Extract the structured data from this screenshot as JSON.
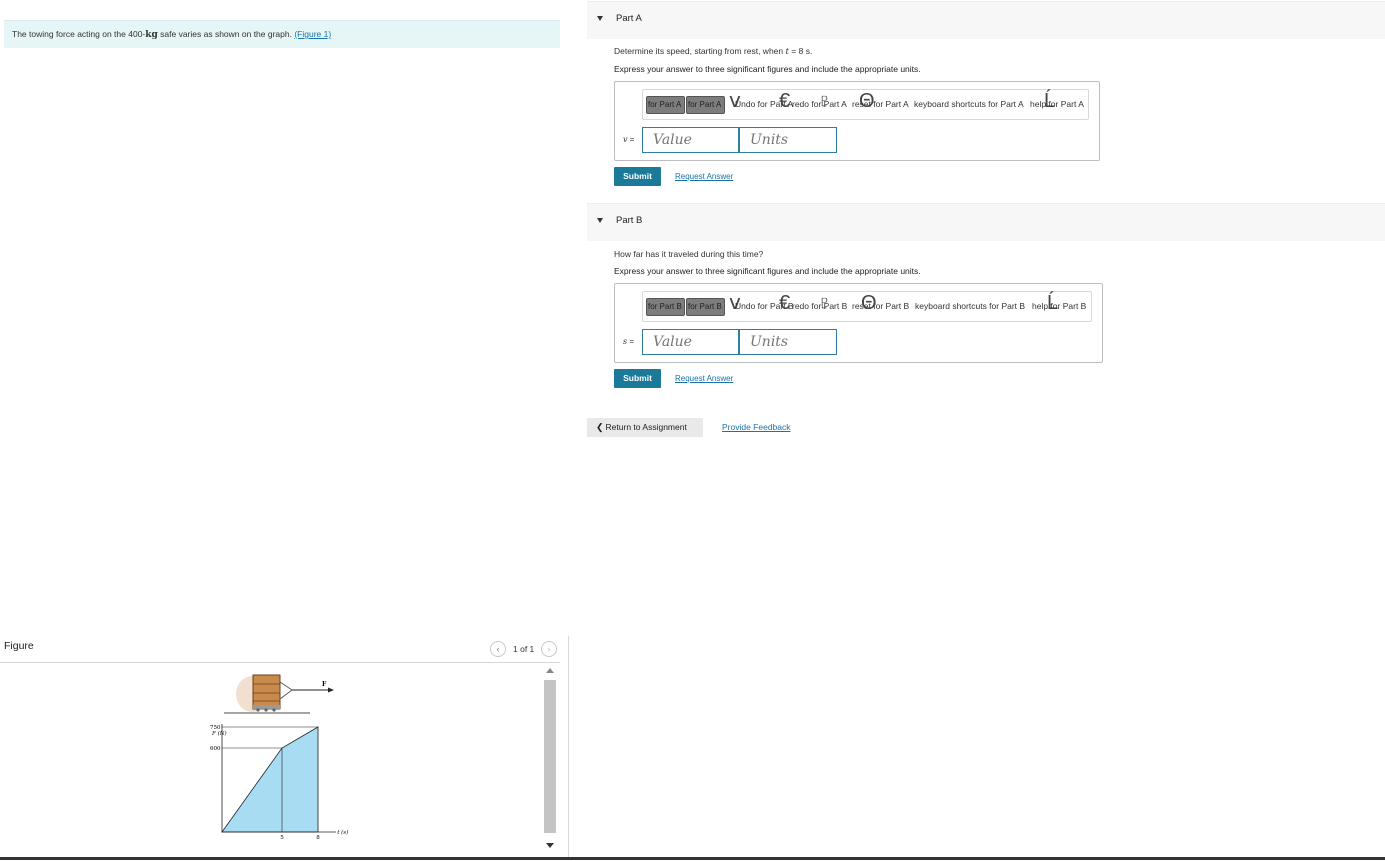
{
  "problem": {
    "text": "The towing force acting on the 400-",
    "unit": "kg",
    "text_after": " safe varies as shown on the graph. ",
    "figure_link": "(Figure 1)"
  },
  "figure": {
    "title": "Figure",
    "pager": "1 of 1",
    "force_label": "F",
    "y_axis_label": "F (N)",
    "y_tick_high": "750",
    "y_tick_low": "600",
    "x_tick_1": "5",
    "x_tick_2": "8",
    "x_axis_label": "t (s)"
  },
  "chart_data": {
    "type": "area",
    "x": [
      0,
      5,
      5,
      8
    ],
    "y": [
      0,
      600,
      600,
      750
    ],
    "xlabel": "t (s)",
    "ylabel": "F (N)",
    "x_ticks": [
      5,
      8
    ],
    "y_ticks": [
      600,
      750
    ],
    "xlim": [
      0,
      10
    ],
    "ylim": [
      0,
      800
    ],
    "fill_color": "#a8dcf3",
    "grid": false
  },
  "partA": {
    "title": "Part A",
    "question_prefix": "Determine its speed, starting from rest, when ",
    "question_var": "t",
    "question_suffix": " = 8 s.",
    "instruction": "Express your answer to three significant figures and include the appropriate units.",
    "toolbar": {
      "btn1": "for Part A",
      "btn2": "for Part A",
      "undo": "Undo for Part A",
      "redo": "redo for Part A",
      "reset": "reset for Part A",
      "shortcuts": "keyboard shortcuts for Part A",
      "help": "help for Part A"
    },
    "variable": "v",
    "equals": " =",
    "value_placeholder": "Value",
    "units_placeholder": "Units",
    "submit": "Submit",
    "request_answer": "Request Answer"
  },
  "partB": {
    "title": "Part B",
    "question": "How far has it traveled during this time?",
    "instruction": "Express your answer to three significant figures and include the appropriate units.",
    "toolbar": {
      "btn1": "for Part B",
      "btn2": "for Part B",
      "undo": "Undo for Part B",
      "redo": "redo for Part B",
      "reset": "reset for Part B",
      "shortcuts": "keyboard shortcuts for Part B",
      "help": "help for Part B"
    },
    "variable": "s",
    "equals": " =",
    "value_placeholder": "Value",
    "units_placeholder": "Units",
    "submit": "Submit",
    "request_answer": "Request Answer"
  },
  "footer": {
    "return_label": "Return to Assignment",
    "feedback_label": "Provide Feedback"
  },
  "icons": {
    "collapse": "caret-down-icon",
    "prev": "chevron-left-icon",
    "next": "chevron-right-icon",
    "return": "chevron-left-icon"
  },
  "colors": {
    "accent": "#1b7a99",
    "link": "#1a73a8",
    "problem_bg": "#e6f5f5",
    "area_fill": "#a8dcf3"
  }
}
